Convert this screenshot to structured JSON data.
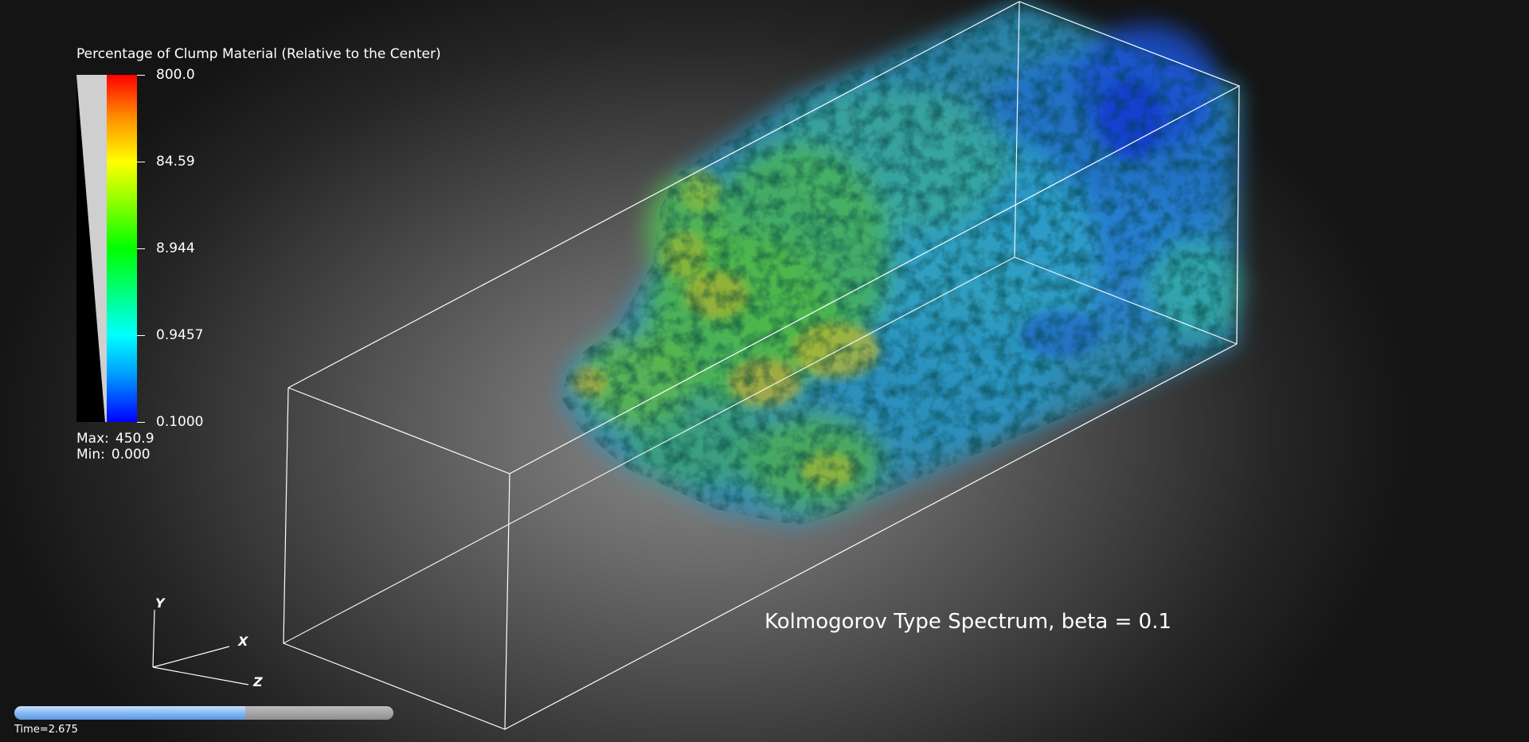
{
  "legend": {
    "title": "Percentage of Clump Material (Relative to the Center)",
    "ticks": [
      "800.0",
      "84.59",
      "8.944",
      "0.9457",
      "0.1000"
    ],
    "max_label": "Max:",
    "max_value": "450.9",
    "min_label": "Min:",
    "min_value": "0.000",
    "colormap": [
      "#0000ff",
      "#00ffff",
      "#00ff00",
      "#ffff00",
      "#ff0000"
    ]
  },
  "caption": "Kolmogorov Type Spectrum, beta = 0.1",
  "axes": {
    "y_label": "Y",
    "x_label": "X",
    "z_label": "Z"
  },
  "animation": {
    "time_text": "Time=2.675",
    "progress_fraction": 0.61
  },
  "colors": {
    "outline": "#ffffff",
    "progress_fill": "#7db3f0",
    "progress_track": "#a6a6a6"
  }
}
